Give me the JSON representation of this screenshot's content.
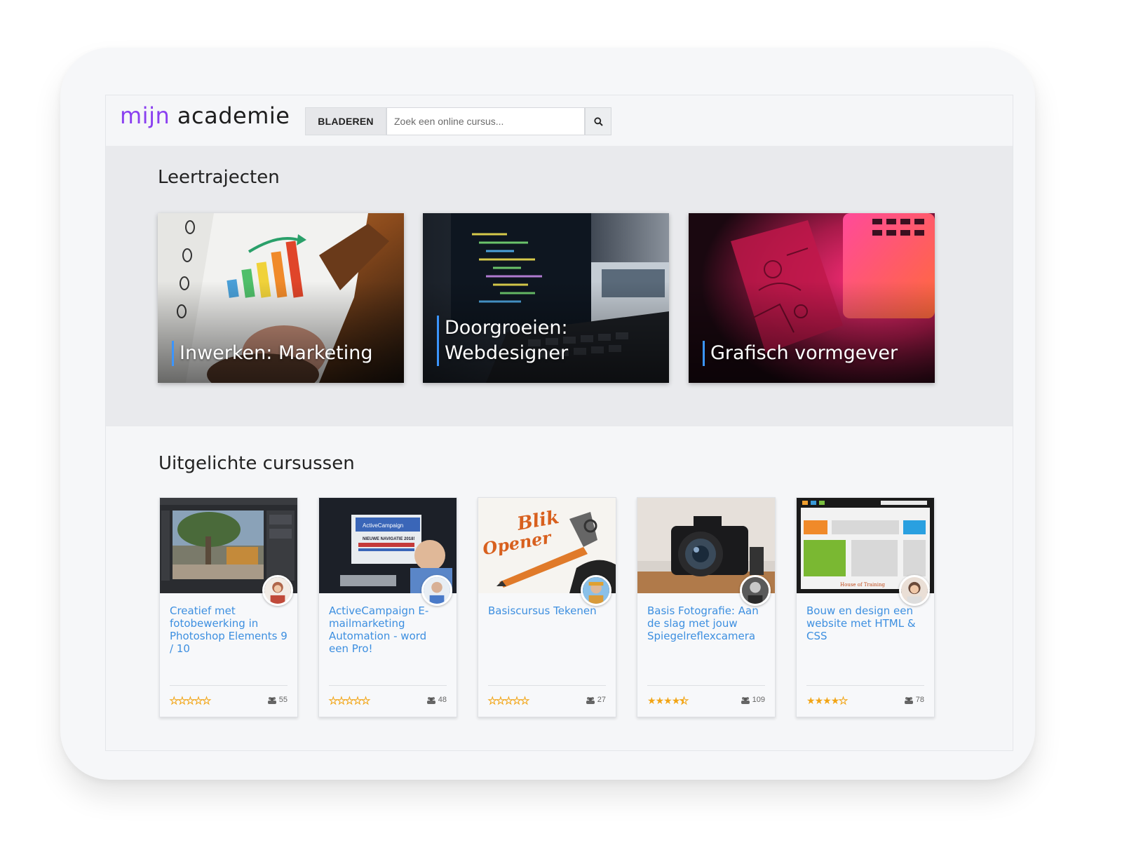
{
  "header": {
    "logo_part1": "mijn",
    "logo_part2": "academie",
    "browse_label": "BLADEREN",
    "search_placeholder": "Zoek een online cursus..."
  },
  "paths": {
    "title": "Leertrajecten",
    "items": [
      {
        "label": "Inwerken: Marketing"
      },
      {
        "label": "Doorgroeien: Webdesigner"
      },
      {
        "label": "Grafisch vormgever"
      }
    ]
  },
  "featured": {
    "title": "Uitgelichte cursussen",
    "courses": [
      {
        "title": "Creatief met fotobewerking in Photoshop Elements 9 / 10",
        "rating": 0,
        "students": "55"
      },
      {
        "title": "ActiveCampaign E-mailmarketing Automation - word een Pro!",
        "rating": 0,
        "students": "48"
      },
      {
        "title": "Basiscursus Tekenen",
        "rating": 0,
        "students": "27"
      },
      {
        "title": "Basis Fotografie: Aan de slag met jouw Spiegelreflexcamera",
        "rating": 4.5,
        "students": "109"
      },
      {
        "title": "Bouw en design een website met HTML & CSS",
        "rating": 4,
        "students": "78"
      }
    ]
  },
  "thumb_text": {
    "activecampaign": "ActiveCampaign",
    "nieuwe": "NIEUWE NAVIGATIE 2018!",
    "blik": "Blik",
    "opener": "Opener",
    "house": "House of Training"
  },
  "colors": {
    "brand": "#8a3ff0",
    "link": "#3d8fe0",
    "star": "#f2a516",
    "accent_bar": "#3b95ff"
  }
}
